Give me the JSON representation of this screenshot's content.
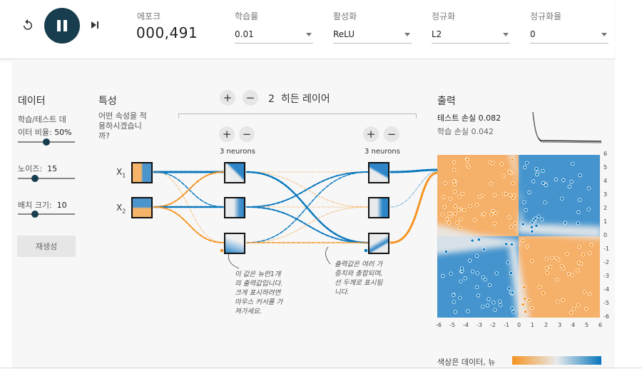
{
  "controls": {
    "reset_icon": "reset-icon",
    "play_state_icon": "pause-icon",
    "step_icon": "step-forward-icon"
  },
  "epoch": {
    "label": "에포크",
    "value": "000,491"
  },
  "dropdowns": [
    {
      "label": "학습률",
      "value": "0.01"
    },
    {
      "label": "활성화",
      "value": "ReLU"
    },
    {
      "label": "정규화",
      "value": "L2"
    },
    {
      "label": "정규화율",
      "value": "0"
    }
  ],
  "data_panel": {
    "title": "데이터",
    "ratio_label_1": "학습/테스트 데",
    "ratio_label_2": "이터 비율:",
    "ratio_value": "50%",
    "ratio_fraction": 0.5,
    "noise_label": "노이즈:",
    "noise_value": "15",
    "noise_fraction": 0.3,
    "batch_label": "배치 크기:",
    "batch_value": "10",
    "batch_fraction": 0.3,
    "regenerate": "재생성"
  },
  "features": {
    "title": "특성",
    "question_1": "어떤 속성을 적",
    "question_2": "용하시겠습니",
    "question_3": "까?",
    "x1": "X",
    "x1_sub": "1",
    "x2": "X",
    "x2_sub": "2"
  },
  "hidden": {
    "count": "2",
    "label": "히든 레이어",
    "layer1_neurons": "3 neurons",
    "layer2_neurons": "3 neurons",
    "plus": "+",
    "minus": "−"
  },
  "notes": {
    "note1": [
      "이 값은 뉴런1개",
      "의 출력값입니다.",
      "크게 표시하려면",
      "마우스 커서를 가",
      "져가세요."
    ],
    "note2": [
      "출력값은 여러 가",
      "중치와 총합되며,",
      "선 두께로 표시됩",
      "니다."
    ]
  },
  "output": {
    "title": "출력",
    "test_loss_label": "테스트 손실",
    "test_loss": "0.082",
    "train_loss_label": "학습 손실",
    "train_loss": "0.042",
    "x_ticks": [
      "-6",
      "-5",
      "-4",
      "-3",
      "-2",
      "-1",
      "0",
      "1",
      "2",
      "3",
      "4",
      "5",
      "6"
    ],
    "y_ticks": [
      "6",
      "5",
      "4",
      "3",
      "2",
      "1",
      "0",
      "-1",
      "-2",
      "-3",
      "-4",
      "-5",
      "-6"
    ],
    "legend_text": "색상은 데이터, 뉴",
    "colors": {
      "orange": "#f59322",
      "blue": "#0877bd",
      "neutral": "#e8eaeb"
    }
  }
}
